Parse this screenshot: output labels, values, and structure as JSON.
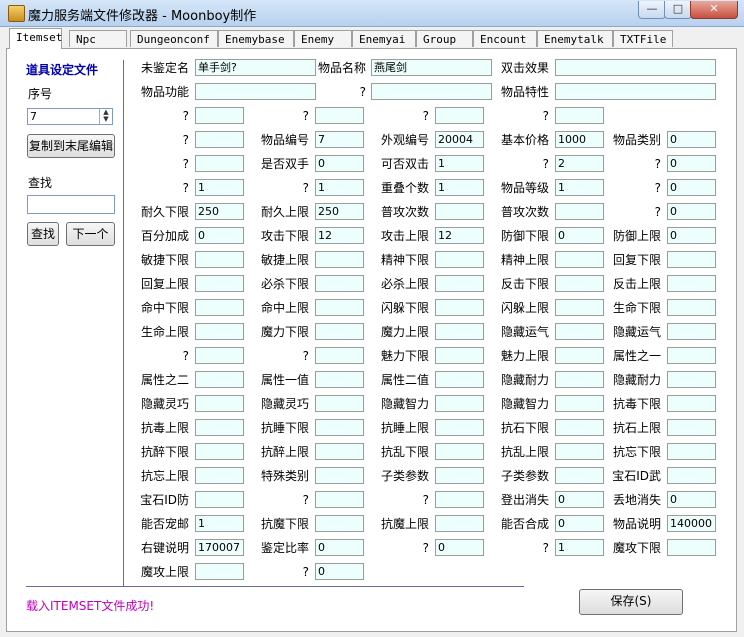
{
  "window": {
    "title": "魔力服务端文件修改器 - Moonboy制作",
    "minimize": "—",
    "maximize": "□",
    "close": "✕"
  },
  "tabs": [
    "Itemset",
    "Npc",
    "Dungeonconf",
    "Enemybase",
    "Enemy",
    "Enemyai",
    "Group",
    "Encount",
    "Enemytalk",
    "TXTFile"
  ],
  "sidebar": {
    "title": "道具设定文件",
    "index_label": "序号",
    "index_value": "7",
    "copy_button": "复制到末尾编辑",
    "search_label": "查找",
    "search_value": "",
    "search_button": "查找",
    "next_button": "下一个"
  },
  "status_message": "载入ITEMSET文件成功!",
  "save_button": "保存(S)",
  "rows": [
    [
      [
        "未鉴定名",
        "单手剑?"
      ],
      [
        "物品名称",
        "燕尾剑"
      ],
      [
        "双击效果",
        ""
      ]
    ],
    [
      [
        "物品功能",
        ""
      ],
      [
        "?",
        ""
      ],
      [
        "物品特性",
        ""
      ]
    ],
    [
      [
        "?",
        ""
      ],
      [
        "?",
        ""
      ],
      [
        "?",
        ""
      ],
      [
        "?",
        ""
      ]
    ],
    [
      [
        "?",
        ""
      ],
      [
        "物品编号",
        "7"
      ],
      [
        "外观编号",
        "20004"
      ],
      [
        "基本价格",
        "1000"
      ],
      [
        "物品类别",
        "0"
      ]
    ],
    [
      [
        "?",
        ""
      ],
      [
        "是否双手",
        "0"
      ],
      [
        "可否双击",
        "1"
      ],
      [
        "?",
        "2"
      ],
      [
        "?",
        "0"
      ]
    ],
    [
      [
        "?",
        "1"
      ],
      [
        "?",
        "1"
      ],
      [
        "重叠个数",
        "1"
      ],
      [
        "物品等级",
        "1"
      ],
      [
        "?",
        "0"
      ]
    ],
    [
      [
        "耐久下限",
        "250"
      ],
      [
        "耐久上限",
        "250"
      ],
      [
        "普攻次数",
        ""
      ],
      [
        "普攻次数",
        ""
      ],
      [
        "?",
        "0"
      ]
    ],
    [
      [
        "百分加成",
        "0"
      ],
      [
        "攻击下限",
        "12"
      ],
      [
        "攻击上限",
        "12"
      ],
      [
        "防御下限",
        "0"
      ],
      [
        "防御上限",
        "0"
      ]
    ],
    [
      [
        "敏捷下限",
        ""
      ],
      [
        "敏捷上限",
        ""
      ],
      [
        "精神下限",
        ""
      ],
      [
        "精神上限",
        ""
      ],
      [
        "回复下限",
        ""
      ]
    ],
    [
      [
        "回复上限",
        ""
      ],
      [
        "必杀下限",
        ""
      ],
      [
        "必杀上限",
        ""
      ],
      [
        "反击下限",
        ""
      ],
      [
        "反击上限",
        ""
      ]
    ],
    [
      [
        "命中下限",
        ""
      ],
      [
        "命中上限",
        ""
      ],
      [
        "闪躲下限",
        ""
      ],
      [
        "闪躲上限",
        ""
      ],
      [
        "生命下限",
        ""
      ]
    ],
    [
      [
        "生命上限",
        ""
      ],
      [
        "魔力下限",
        ""
      ],
      [
        "魔力上限",
        ""
      ],
      [
        "隐藏运气",
        ""
      ],
      [
        "隐藏运气",
        ""
      ]
    ],
    [
      [
        "?",
        ""
      ],
      [
        "?",
        ""
      ],
      [
        "魅力下限",
        ""
      ],
      [
        "魅力上限",
        ""
      ],
      [
        "属性之一",
        ""
      ]
    ],
    [
      [
        "属性之二",
        ""
      ],
      [
        "属性一值",
        ""
      ],
      [
        "属性二值",
        ""
      ],
      [
        "隐藏耐力",
        ""
      ],
      [
        "隐藏耐力",
        ""
      ]
    ],
    [
      [
        "隐藏灵巧",
        ""
      ],
      [
        "隐藏灵巧",
        ""
      ],
      [
        "隐藏智力",
        ""
      ],
      [
        "隐藏智力",
        ""
      ],
      [
        "抗毒下限",
        ""
      ]
    ],
    [
      [
        "抗毒上限",
        ""
      ],
      [
        "抗睡下限",
        ""
      ],
      [
        "抗睡上限",
        ""
      ],
      [
        "抗石下限",
        ""
      ],
      [
        "抗石上限",
        ""
      ]
    ],
    [
      [
        "抗醉下限",
        ""
      ],
      [
        "抗醉上限",
        ""
      ],
      [
        "抗乱下限",
        ""
      ],
      [
        "抗乱上限",
        ""
      ],
      [
        "抗忘下限",
        ""
      ]
    ],
    [
      [
        "抗忘上限",
        ""
      ],
      [
        "特殊类别",
        ""
      ],
      [
        "子类参数",
        ""
      ],
      [
        "子类参数",
        ""
      ],
      [
        "宝石ID武",
        ""
      ]
    ],
    [
      [
        "宝石ID防",
        ""
      ],
      [
        "?",
        ""
      ],
      [
        "?",
        ""
      ],
      [
        "登出消失",
        "0"
      ],
      [
        "丢地消失",
        "0"
      ]
    ],
    [
      [
        "能否宠邮",
        "1"
      ],
      [
        "抗魔下限",
        ""
      ],
      [
        "抗魔上限",
        ""
      ],
      [
        "能否合成",
        "0"
      ],
      [
        "物品说明",
        "140000"
      ]
    ],
    [
      [
        "右键说明",
        "170007"
      ],
      [
        "鉴定比率",
        "0"
      ],
      [
        "?",
        "0"
      ],
      [
        "?",
        "1"
      ],
      [
        "魔攻下限",
        ""
      ]
    ],
    [
      [
        "魔攻上限",
        ""
      ],
      [
        "?",
        "0"
      ]
    ]
  ]
}
